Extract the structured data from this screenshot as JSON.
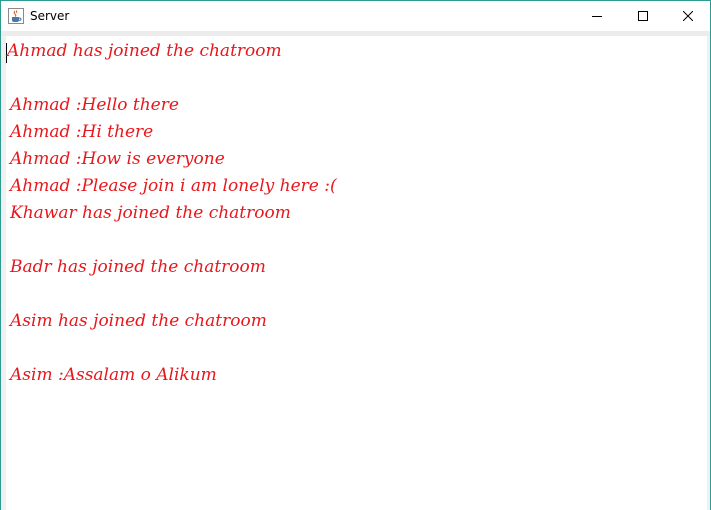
{
  "window": {
    "title": "Server",
    "icon": "java-cup-icon"
  },
  "colors": {
    "message_text": "#e8171c",
    "border": "#2b9c8f"
  },
  "chat": {
    "lines": [
      "Ahmad has joined the chatroom",
      "",
      "Ahmad :Hello there",
      "Ahmad :Hi there",
      "Ahmad :How is everyone",
      "Ahmad :Please join i am lonely here :(",
      "Khawar has joined the chatroom",
      "",
      "Badr has joined the chatroom",
      "",
      "Asim has joined the chatroom",
      "",
      "Asim :Assalam o Alikum"
    ]
  }
}
